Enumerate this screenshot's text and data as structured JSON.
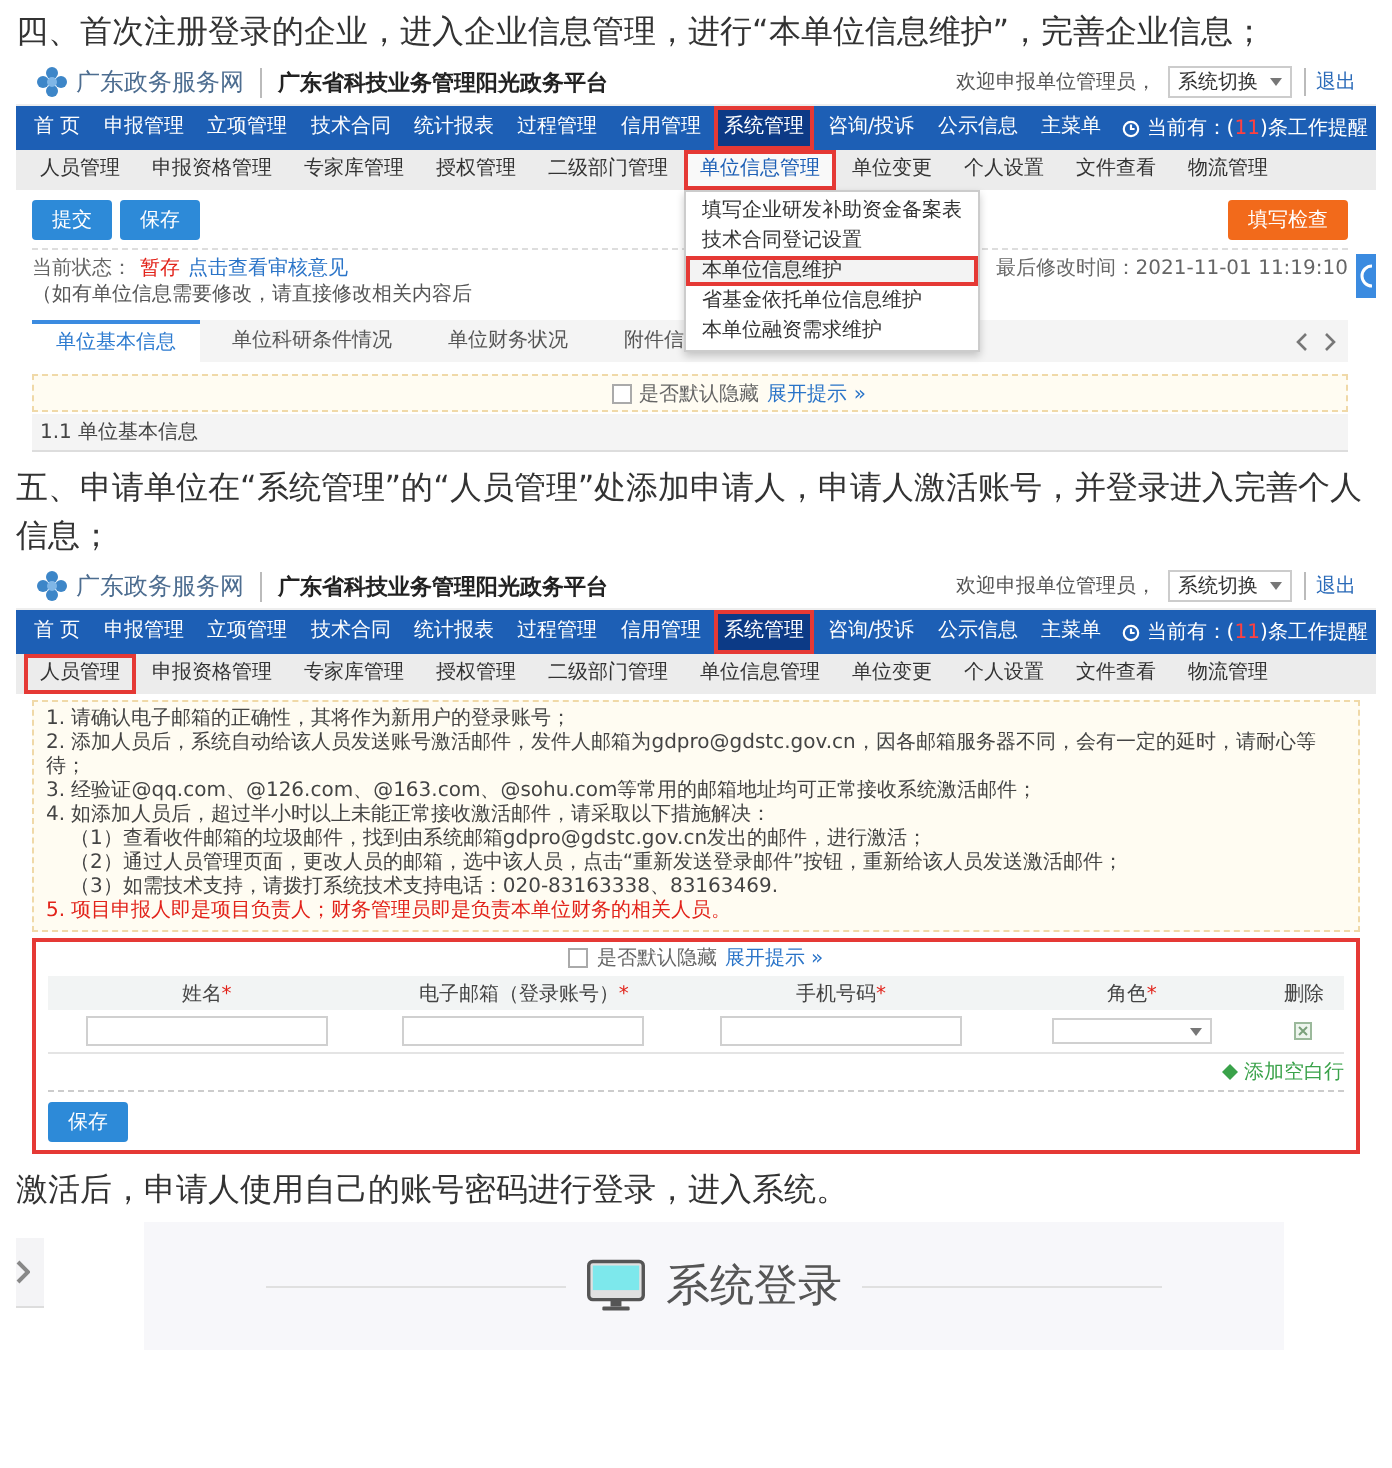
{
  "heading_1": "四、首次注册登录的企业，进入企业信息管理，进行“本单位信息维护”，完善企业信息；",
  "screenshot_1": {
    "header": {
      "site_name": "广东政务服务网",
      "platform_title": "广东省科技业务管理阳光政务平台",
      "welcome": "欢迎申报单位管理员，",
      "system_switch": "系统切换",
      "logout": "退出"
    },
    "nav": [
      {
        "label": "首 页",
        "selected": false,
        "highlighted": false
      },
      {
        "label": "申报管理",
        "selected": false,
        "highlighted": false
      },
      {
        "label": "立项管理",
        "selected": false,
        "highlighted": false
      },
      {
        "label": "技术合同",
        "selected": false,
        "highlighted": false
      },
      {
        "label": "统计报表",
        "selected": false,
        "highlighted": false
      },
      {
        "label": "过程管理",
        "selected": false,
        "highlighted": false
      },
      {
        "label": "信用管理",
        "selected": false,
        "highlighted": false
      },
      {
        "label": "系统管理",
        "selected": true,
        "highlighted": true
      },
      {
        "label": "咨询/投诉",
        "selected": false,
        "highlighted": false
      },
      {
        "label": "公示信息",
        "selected": false,
        "highlighted": false
      },
      {
        "label": "主菜单",
        "selected": false,
        "highlighted": false
      }
    ],
    "reminder": {
      "text": "当前有：(",
      "count": "11",
      "suffix": ")条工作提醒"
    },
    "subnav": [
      {
        "label": "人员管理",
        "highlighted": false,
        "expanded": false
      },
      {
        "label": "申报资格管理",
        "highlighted": false,
        "expanded": false
      },
      {
        "label": "专家库管理",
        "highlighted": false,
        "expanded": false
      },
      {
        "label": "授权管理",
        "highlighted": false,
        "expanded": false
      },
      {
        "label": "二级部门管理",
        "highlighted": false,
        "expanded": false
      },
      {
        "label": "单位信息管理",
        "highlighted": true,
        "expanded": true
      },
      {
        "label": "单位变更",
        "highlighted": false,
        "expanded": false
      },
      {
        "label": "个人设置",
        "highlighted": false,
        "expanded": false
      },
      {
        "label": "文件查看",
        "highlighted": false,
        "expanded": false
      },
      {
        "label": "物流管理",
        "highlighted": false,
        "expanded": false
      }
    ],
    "dropdown": [
      {
        "label": "填写企业研发补助资金备案表",
        "highlighted": false
      },
      {
        "label": "技术合同登记设置",
        "highlighted": false
      },
      {
        "label": "本单位信息维护",
        "highlighted": true
      },
      {
        "label": "省基金依托单位信息维护",
        "highlighted": false
      },
      {
        "label": "本单位融资需求维护",
        "highlighted": false
      }
    ],
    "action_buttons": [
      {
        "label": "提交"
      },
      {
        "label": "保存"
      }
    ],
    "check_button": "填写检查",
    "status": {
      "label": "当前状态：",
      "value": "暂存",
      "link": "点击查看审核意见",
      "note": "（如有单位信息需要修改，请直接修改相关内容后"
    },
    "last_modified": "最后修改时间：2021-11-01 11:19:10",
    "tabs": [
      {
        "label": "单位基本信息",
        "selected": true
      },
      {
        "label": "单位科研条件情况",
        "selected": false
      },
      {
        "label": "单位财务状况",
        "selected": false
      },
      {
        "label": "附件信",
        "selected": false
      }
    ],
    "tip": {
      "label": "是否默认隐藏",
      "checked": false,
      "toggle": "展开提示 »"
    },
    "section_title": "1.1 单位基本信息"
  },
  "heading_2": "五、申请单位在“系统管理”的“人员管理”处添加申请人，申请人激活账号，并登录进入完善个人信息；",
  "screenshot_2": {
    "header": {
      "site_name": "广东政务服务网",
      "platform_title": "广东省科技业务管理阳光政务平台",
      "welcome": "欢迎申报单位管理员，",
      "system_switch": "系统切换",
      "logout": "退出"
    },
    "nav": [
      {
        "label": "首 页",
        "selected": false,
        "highlighted": false
      },
      {
        "label": "申报管理",
        "selected": false,
        "highlighted": false
      },
      {
        "label": "立项管理",
        "selected": false,
        "highlighted": false
      },
      {
        "label": "技术合同",
        "selected": false,
        "highlighted": false
      },
      {
        "label": "统计报表",
        "selected": false,
        "highlighted": false
      },
      {
        "label": "过程管理",
        "selected": false,
        "highlighted": false
      },
      {
        "label": "信用管理",
        "selected": false,
        "highlighted": false
      },
      {
        "label": "系统管理",
        "selected": true,
        "highlighted": true
      },
      {
        "label": "咨询/投诉",
        "selected": false,
        "highlighted": false
      },
      {
        "label": "公示信息",
        "selected": false,
        "highlighted": false
      },
      {
        "label": "主菜单",
        "selected": false,
        "highlighted": false
      }
    ],
    "reminder": {
      "text": "当前有：(",
      "count": "11",
      "suffix": ")条工作提醒"
    },
    "subnav": [
      {
        "label": "人员管理",
        "highlighted": true
      },
      {
        "label": "申报资格管理",
        "highlighted": false
      },
      {
        "label": "专家库管理",
        "highlighted": false
      },
      {
        "label": "授权管理",
        "highlighted": false
      },
      {
        "label": "二级部门管理",
        "highlighted": false
      },
      {
        "label": "单位信息管理",
        "highlighted": false
      },
      {
        "label": "单位变更",
        "highlighted": false
      },
      {
        "label": "个人设置",
        "highlighted": false
      },
      {
        "label": "文件查看",
        "highlighted": false
      },
      {
        "label": "物流管理",
        "highlighted": false
      }
    ],
    "notices": [
      {
        "text": "1. 请确认电子邮箱的正确性，其将作为新用户的登录账号；",
        "kind": "item"
      },
      {
        "text": "2. 添加人员后，系统自动给该人员发送账号激活邮件，发件人邮箱为gdpro@gdstc.gov.cn，因各邮箱服务器不同，会有一定的延时，请耐心等待；",
        "kind": "item"
      },
      {
        "text": "3. 经验证@qq.com、@126.com、@163.com、@sohu.com等常用的邮箱地址均可正常接收系统激活邮件；",
        "kind": "item"
      },
      {
        "text": "4. 如添加人员后，超过半小时以上未能正常接收激活邮件，请采取以下措施解决：",
        "kind": "item"
      },
      {
        "text": "（1）查看收件邮箱的垃圾邮件，找到由系统邮箱gdpro@gdstc.gov.cn发出的邮件，进行激活；",
        "kind": "sub"
      },
      {
        "text": "（2）通过人员管理页面，更改人员的邮箱，选中该人员，点击“重新发送登录邮件”按钮，重新给该人员发送激活邮件；",
        "kind": "sub"
      },
      {
        "text": "（3）如需技术支持，请拨打系统技术支持电话：020-83163338、83163469.",
        "kind": "sub"
      },
      {
        "text": "5. 项目申报人即是项目负责人；财务管理员即是负责本单位财务的相关人员。",
        "kind": "warning"
      }
    ],
    "tip": {
      "label": "是否默认隐藏",
      "checked": false,
      "toggle": "展开提示 »"
    },
    "form": {
      "highlighted": true,
      "columns": [
        {
          "label": "姓名",
          "required_mark": "*",
          "kind": "text"
        },
        {
          "label": "电子邮箱（登录账号）",
          "required_mark": "*",
          "kind": "text"
        },
        {
          "label": "手机号码",
          "required_mark": "*",
          "kind": "text"
        },
        {
          "label": "角色",
          "required_mark": "*",
          "kind": "select"
        },
        {
          "label": "删除",
          "kind": "delete"
        }
      ],
      "add_row": "添加空白行",
      "save": "保存"
    }
  },
  "paragraph": "激活后，申请人使用自己的账号密码进行登录，进入系统。",
  "login_banner": {
    "title": "系统登录"
  }
}
